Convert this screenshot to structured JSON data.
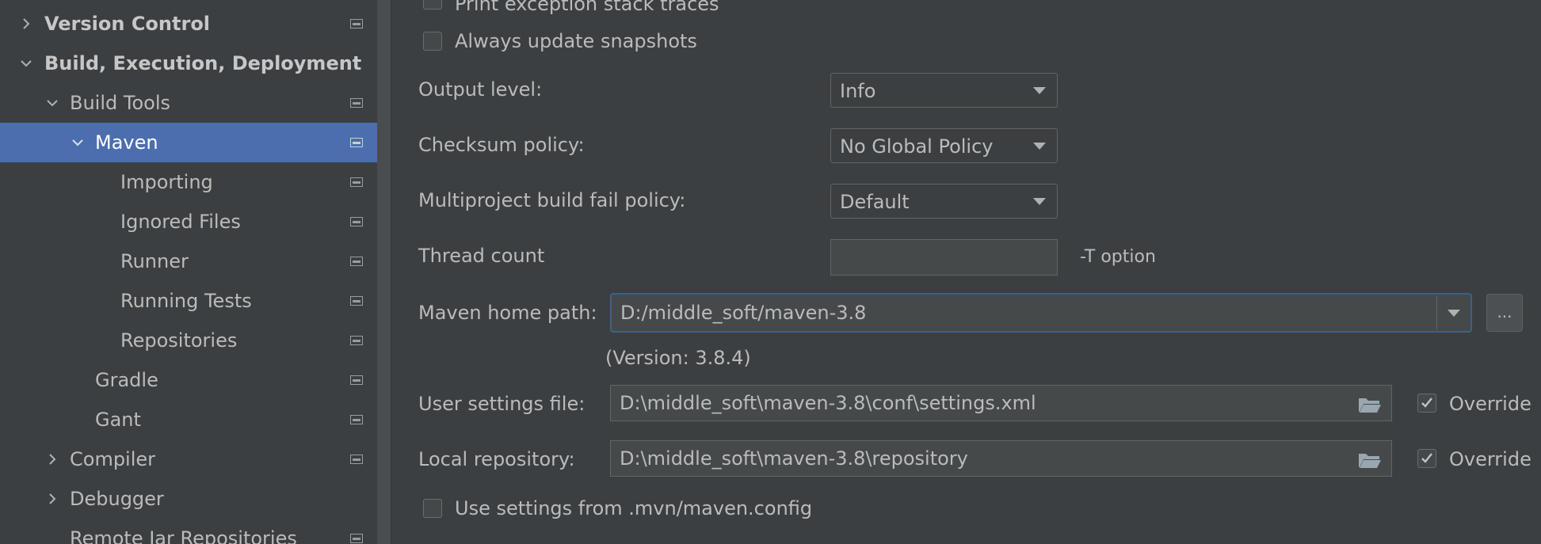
{
  "sidebar": {
    "items": [
      {
        "label": "Version Control",
        "icon": "project-level-icon",
        "chevron": "chevron-right-icon",
        "bold": true
      },
      {
        "label": "Build, Execution, Deployment",
        "chevron": "chevron-down-icon",
        "bold": true
      },
      {
        "label": "Build Tools",
        "icon": "project-level-icon",
        "chevron": "chevron-down-icon"
      },
      {
        "label": "Maven",
        "icon": "project-level-icon",
        "chevron": "chevron-down-icon",
        "selected": true
      },
      {
        "label": "Importing",
        "icon": "project-level-icon"
      },
      {
        "label": "Ignored Files",
        "icon": "project-level-icon"
      },
      {
        "label": "Runner",
        "icon": "project-level-icon"
      },
      {
        "label": "Running Tests",
        "icon": "project-level-icon"
      },
      {
        "label": "Repositories",
        "icon": "project-level-icon"
      },
      {
        "label": "Gradle",
        "icon": "project-level-icon"
      },
      {
        "label": "Gant",
        "icon": "project-level-icon"
      },
      {
        "label": "Compiler",
        "icon": "project-level-icon",
        "chevron": "chevron-right-icon"
      },
      {
        "label": "Debugger",
        "chevron": "chevron-right-icon"
      },
      {
        "label": "Remote Jar Repositories",
        "icon": "project-level-icon"
      }
    ]
  },
  "main": {
    "print_stack_traces": {
      "label": "Print exception stack traces",
      "checked": false
    },
    "always_update_snapshots": {
      "label": "Always update snapshots",
      "checked": false
    },
    "output_level": {
      "label": "Output level:",
      "value": "Info"
    },
    "checksum_policy": {
      "label": "Checksum policy:",
      "value": "No Global Policy"
    },
    "fail_policy": {
      "label": "Multiproject build fail policy:",
      "value": "Default"
    },
    "thread_count": {
      "label": "Thread count",
      "value": "",
      "hint": "-T option"
    },
    "maven_home": {
      "label": "Maven home path:",
      "value": "D:/middle_soft/maven-3.8",
      "version": "(Version: 3.8.4)",
      "browse_label": "..."
    },
    "user_settings": {
      "label": "User settings file:",
      "value": "D:\\middle_soft\\maven-3.8\\conf\\settings.xml",
      "override_label": "Override",
      "override_checked": true
    },
    "local_repo": {
      "label": "Local repository:",
      "value": "D:\\middle_soft\\maven-3.8\\repository",
      "override_label": "Override",
      "override_checked": true
    },
    "use_mvn_config": {
      "label": "Use settings from .mvn/maven.config",
      "checked": false
    }
  },
  "colors": {
    "background": "#3c3f41",
    "selection": "#4b6eaf",
    "focus_border": "#3d6185",
    "text": "#bbbbbb"
  }
}
